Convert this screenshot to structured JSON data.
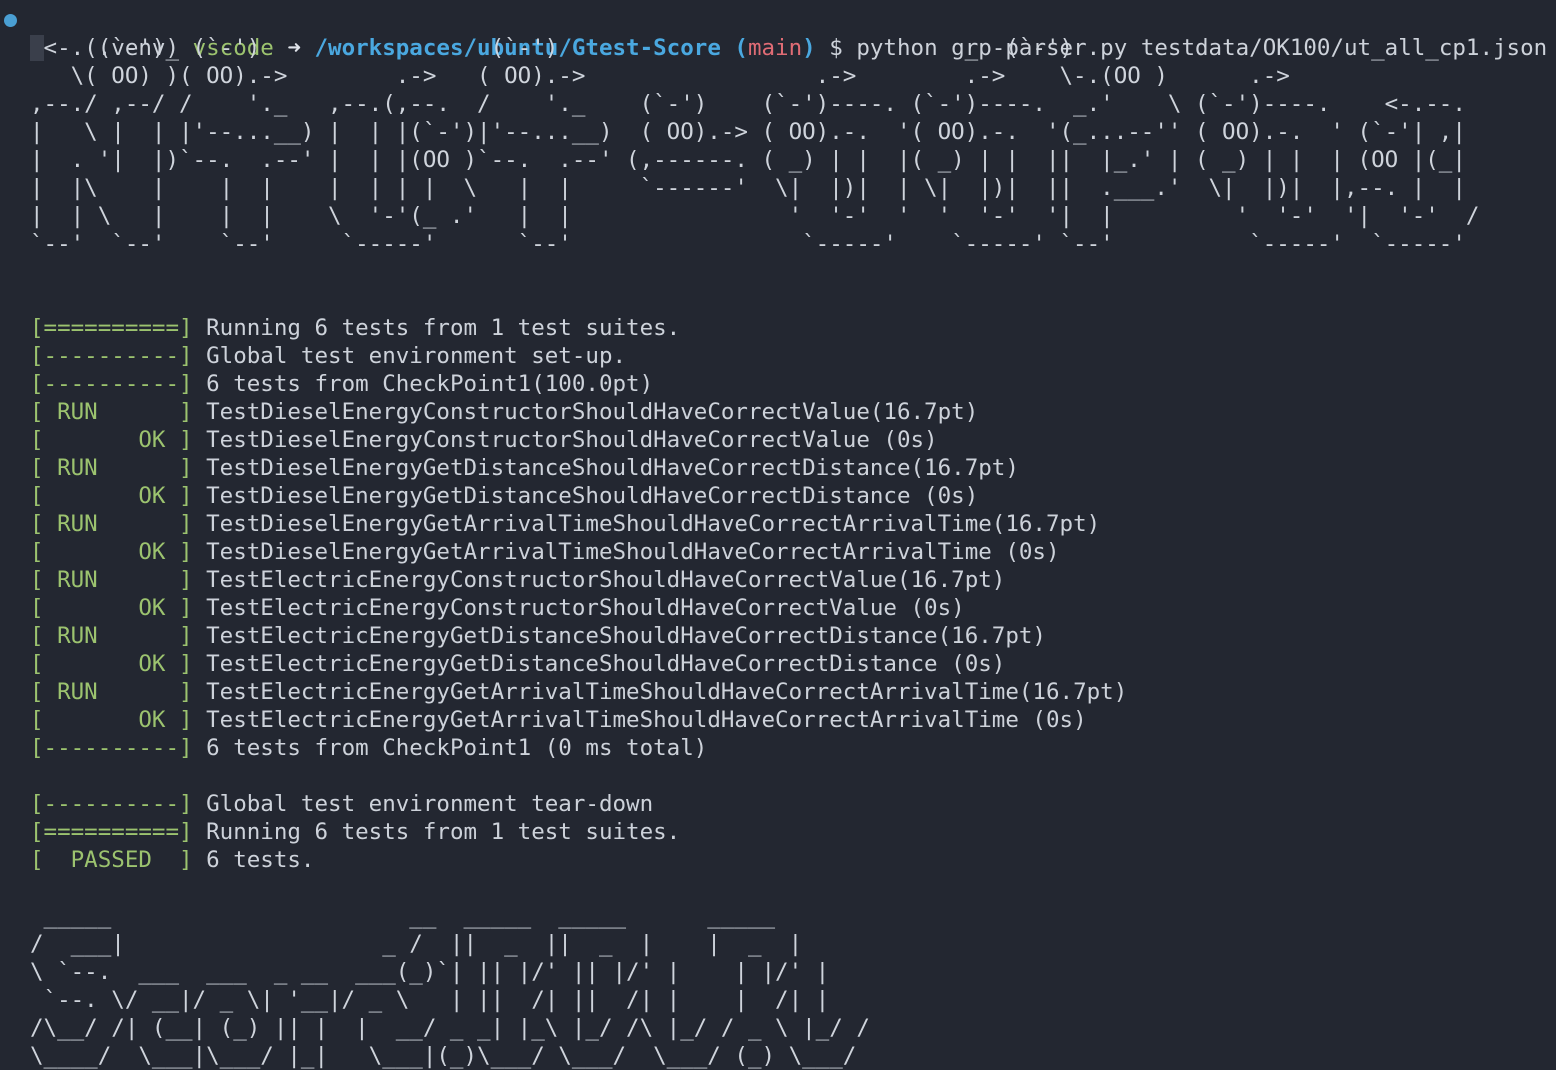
{
  "prompt": {
    "venv": "(.venv)",
    "user": "vscode",
    "arrow": "➜",
    "path": "/workspaces/ubuntu/Gtest-Score",
    "branch_open": "(",
    "branch": "main",
    "branch_close": ")",
    "symbol": "$",
    "command": "python grp-parser.py testdata/OK100/ut_all_cp1.json"
  },
  "banner_art": [
    "<-. (`-')_ (`-')                 (`-')                              _  (`-')",
    "   \\( OO) )( OO).->        .->   ( OO).->                 .->        .->    \\-.(OO )      .->",
    ",--./ ,--/ /    '._   ,--.(,--.  /    '._    (`-')    (`-')----. (`-')----.  _.'    \\ (`-')----.    <-.--.",
    "|   \\ |  | |'--...__) |  | |(`-')|'--...__)  ( OO).-> ( OO).-.  '( OO).-.  '(_...--'' ( OO).-.  ' (`-'| ,|",
    "|  . '|  |)`--.  .--' |  | |(OO )`--.  .--' (,------. ( _) | |  |( _) | |  ||  |_.' | ( _) | |  | (OO |(_|",
    "|  |\\    |    |  |    |  | | |  \\   |  |     `------'  \\|  |)|  | \\|  |)|  ||  .___.'  \\|  |)|  |,--. |  |",
    "|  | \\   |    |  |    \\  '-'(_ .'   |  |                '  '-'  '  '  '-'  '|  |         '  '-'  '|  '-'  /",
    "`--'  `--'    `--'     `-----'      `--'                 `-----'    `-----' `--'          `-----'  `-----'"
  ],
  "gtest_lines": [
    {
      "tag": "[==========]",
      "text": "Running 6 tests from 1 test suites."
    },
    {
      "tag": "[----------]",
      "text": "Global test environment set-up."
    },
    {
      "tag": "[----------]",
      "text": "6 tests from CheckPoint1(100.0pt)"
    },
    {
      "tag": "[ RUN      ]",
      "text": "TestDieselEnergyConstructorShouldHaveCorrectValue(16.7pt)"
    },
    {
      "tag": "[       OK ]",
      "text": "TestDieselEnergyConstructorShouldHaveCorrectValue (0s)"
    },
    {
      "tag": "[ RUN      ]",
      "text": "TestDieselEnergyGetDistanceShouldHaveCorrectDistance(16.7pt)"
    },
    {
      "tag": "[       OK ]",
      "text": "TestDieselEnergyGetDistanceShouldHaveCorrectDistance (0s)"
    },
    {
      "tag": "[ RUN      ]",
      "text": "TestDieselEnergyGetArrivalTimeShouldHaveCorrectArrivalTime(16.7pt)"
    },
    {
      "tag": "[       OK ]",
      "text": "TestDieselEnergyGetArrivalTimeShouldHaveCorrectArrivalTime (0s)"
    },
    {
      "tag": "[ RUN      ]",
      "text": "TestElectricEnergyConstructorShouldHaveCorrectValue(16.7pt)"
    },
    {
      "tag": "[       OK ]",
      "text": "TestElectricEnergyConstructorShouldHaveCorrectValue (0s)"
    },
    {
      "tag": "[ RUN      ]",
      "text": "TestElectricEnergyGetDistanceShouldHaveCorrectDistance(16.7pt)"
    },
    {
      "tag": "[       OK ]",
      "text": "TestElectricEnergyGetDistanceShouldHaveCorrectDistance (0s)"
    },
    {
      "tag": "[ RUN      ]",
      "text": "TestElectricEnergyGetArrivalTimeShouldHaveCorrectArrivalTime(16.7pt)"
    },
    {
      "tag": "[       OK ]",
      "text": "TestElectricEnergyGetArrivalTimeShouldHaveCorrectArrivalTime (0s)"
    },
    {
      "tag": "[----------]",
      "text": "6 tests from CheckPoint1 (0 ms total)"
    },
    {
      "tag": "",
      "text": ""
    },
    {
      "tag": "[----------]",
      "text": "Global test environment tear-down"
    },
    {
      "tag": "[==========]",
      "text": "Running 6 tests from 1 test suites."
    },
    {
      "tag": "[  PASSED  ]",
      "text": "6 tests."
    }
  ],
  "score_art": [
    " _____                      __  _____  _____      _____",
    "/  ___|                   _ /  ||  _  ||  _  |    |  _  |",
    "\\ `--.  ___  ___  _ __  ___(_)`| || |/' || |/' |    | |/' |",
    " `--. \\/ __|/ _ \\| '__|/ _ \\   | ||  /| ||  /| |    |  /| |",
    "/\\__/ /| (__| (_) || |  |  __/ _ _| |_\\ |_/ /\\ |_/ / _ \\ |_/ /",
    "\\____/  \\___|\\___/ |_|   \\___|(_)\\___/ \\___/  \\___/ (_) \\___/"
  ],
  "colors": {
    "background": "#232731",
    "text": "#cdd2da",
    "green": "#9cc36f",
    "blue": "#4aa8e0",
    "red": "#e06c75",
    "status_dot": "#4a9fd3"
  }
}
